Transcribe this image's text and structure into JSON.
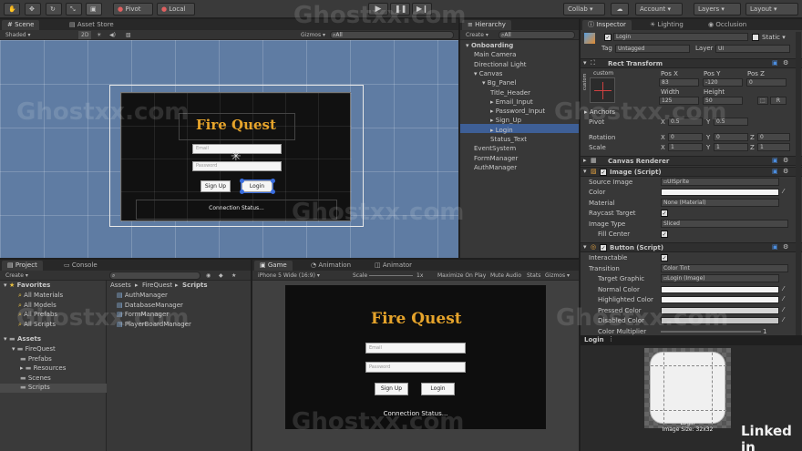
{
  "toolbar": {
    "pivot": "Pivot",
    "local": "Local",
    "collab": "Collab",
    "account": "Account",
    "layers": "Layers",
    "layout": "Layout"
  },
  "scene": {
    "tabs": [
      "Scene",
      "Asset Store"
    ],
    "shaded": "Shaded",
    "mode_2d": "2D",
    "gizmos": "Gizmos",
    "search": "All",
    "title_text": "Fire Quest",
    "email_ph": "Email",
    "password_ph": "Password",
    "signup": "Sign Up",
    "login": "Login",
    "status": "Connection Status..."
  },
  "hierarchy": {
    "tab": "Hierarchy",
    "create": "Create",
    "search": "All",
    "items": [
      {
        "label": "Onboarding",
        "depth": 0
      },
      {
        "label": "Main Camera",
        "depth": 1
      },
      {
        "label": "Directional Light",
        "depth": 1
      },
      {
        "label": "Canvas",
        "depth": 1
      },
      {
        "label": "Bg_Panel",
        "depth": 2
      },
      {
        "label": "Title_Header",
        "depth": 3
      },
      {
        "label": "Email_Input",
        "depth": 3
      },
      {
        "label": "Password_Input",
        "depth": 3
      },
      {
        "label": "Sign_Up",
        "depth": 3
      },
      {
        "label": "Login",
        "depth": 3
      },
      {
        "label": "Status_Text",
        "depth": 3
      },
      {
        "label": "EventSystem",
        "depth": 1
      },
      {
        "label": "FormManager",
        "depth": 1
      },
      {
        "label": "AuthManager",
        "depth": 1
      }
    ]
  },
  "inspector": {
    "tabs": [
      "Inspector",
      "Lighting",
      "Occlusion"
    ],
    "object_name": "Login",
    "static": "Static",
    "tag_label": "Tag",
    "tag_value": "Untagged",
    "layer_label": "Layer",
    "layer_value": "UI",
    "rect_transform": "Rect Transform",
    "custom_top": "custom",
    "custom_side": "custom",
    "pos_x_label": "Pos X",
    "pos_y_label": "Pos Y",
    "pos_z_label": "Pos Z",
    "pos_x": "83",
    "pos_y": "-120",
    "pos_z": "0",
    "width_label": "Width",
    "height_label": "Height",
    "width": "125",
    "height": "50",
    "r_btn": "R",
    "anchors": "Anchors",
    "pivot_label": "Pivot",
    "pivot_x_label": "X",
    "pivot_y_label": "Y",
    "pivot_x": "0.5",
    "pivot_y": "0.5",
    "rotation_label": "Rotation",
    "rot_x_label": "X",
    "rot_y_label": "Y",
    "rot_z_label": "Z",
    "rot_x": "0",
    "rot_y": "0",
    "rot_z": "0",
    "scale_label": "Scale",
    "scale_x": "1",
    "scale_y": "1",
    "scale_z": "1",
    "canvas_renderer": "Canvas Renderer",
    "image_script": "Image (Script)",
    "source_image_label": "Source Image",
    "source_image": "UISprite",
    "color_label": "Color",
    "material_label": "Material",
    "material": "None (Material)",
    "raycast_label": "Raycast Target",
    "image_type_label": "Image Type",
    "image_type": "Sliced",
    "fill_center_label": "Fill Center",
    "button_script": "Button (Script)",
    "interactable_label": "Interactable",
    "transition_label": "Transition",
    "transition": "Color Tint",
    "target_graphic_label": "Target Graphic",
    "target_graphic": "Login (Image)",
    "normal_color_label": "Normal Color",
    "highlighted_color_label": "Highlighted Color",
    "pressed_color_label": "Pressed Color",
    "disabled_color_label": "Disabled Color",
    "color_multiplier_label": "Color Multiplier",
    "color_multiplier": "1",
    "preview_title": "Login",
    "preview_name": "Login",
    "preview_size": "Image Size: 32x32"
  },
  "project": {
    "tabs": [
      "Project",
      "Console"
    ],
    "create": "Create",
    "favorites": "Favorites",
    "fav_items": [
      "All Materials",
      "All Models",
      "All Prefabs",
      "All Scripts"
    ],
    "assets": "Assets",
    "folders": [
      {
        "label": "FireQuest",
        "depth": 1
      },
      {
        "label": "Prefabs",
        "depth": 2
      },
      {
        "label": "Resources",
        "depth": 2
      },
      {
        "label": "Scenes",
        "depth": 2
      },
      {
        "label": "Scripts",
        "depth": 2
      }
    ],
    "breadcrumb": [
      "Assets",
      "FireQuest",
      "Scripts"
    ],
    "files": [
      "AuthManager",
      "DatabaseManager",
      "FormManager",
      "PlayerBoardManager"
    ]
  },
  "game": {
    "tabs": [
      "Game",
      "Animation",
      "Animator"
    ],
    "resolution": "iPhone 5 Wide (16:9)",
    "scale_label": "Scale",
    "scale_value": "1x",
    "maximize": "Maximize On Play",
    "mute": "Mute Audio",
    "stats": "Stats",
    "gizmos": "Gizmos",
    "title_text": "Fire Quest",
    "email_ph": "Email",
    "password_ph": "Password",
    "signup": "Sign Up",
    "login": "Login",
    "status": "Connection Status..."
  },
  "watermark": "Ghostxx.com",
  "brand": "Linked in"
}
